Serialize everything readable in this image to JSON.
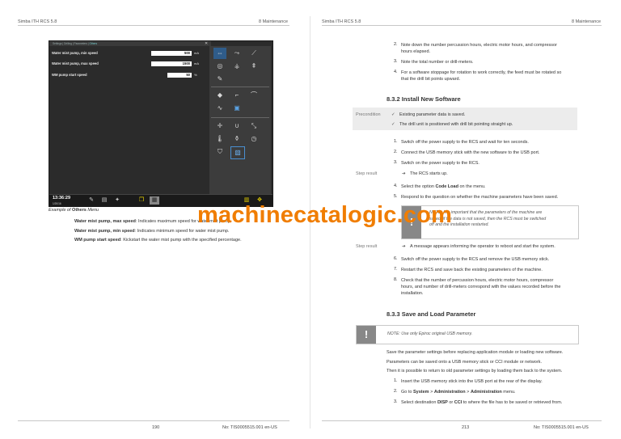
{
  "header": {
    "left_title": "Simba ITH RCS 5.8",
    "left_section": "8 Maintenance",
    "right_title": "Simba ITH RCS 5.8",
    "right_section": "8 Maintenance"
  },
  "screen": {
    "breadcrumb": "Settings | Drilling | Parameters |",
    "breadcrumb_active": "Others",
    "params": [
      {
        "label": "Water mist pump, min speed",
        "value": "500",
        "unit": "mA"
      },
      {
        "label": "Water mist pump, max speed",
        "value": "1500",
        "unit": "mA"
      },
      {
        "label": "WM pump start speed",
        "value": "50",
        "unit": "%"
      }
    ],
    "time": "13:36:29",
    "date": "1/20/16"
  },
  "left": {
    "caption_prefix": "Example of",
    "caption_bold": "Others",
    "caption_suffix": "Menu",
    "descriptions": [
      {
        "term": "Water mist pump, max speed",
        "text": ": Indicates maximum speed for water mist pump."
      },
      {
        "term": "Water mist pump, min speed",
        "text": ": Indicates minimum speed for water mist pump."
      },
      {
        "term": "WM pump start speed",
        "text": ": Kickstart the water mist pump with the specified percentage."
      }
    ],
    "page_number": "190",
    "doc_number": "No: TIS0005515.001 en-US"
  },
  "right": {
    "top_steps": [
      {
        "n": "2.",
        "lines": [
          "Note down the number percussion hours, electric motor hours, and compressor",
          "hours elapsed."
        ]
      },
      {
        "n": "3.",
        "lines": [
          "Note the total number or drill-meters."
        ]
      },
      {
        "n": "4.",
        "lines": [
          "For a software stoppage for rotation to work correctly, the feed must be rotated so",
          "that the drill bit points upward."
        ]
      }
    ],
    "section_install": "8.3.2 Install New Software",
    "precondition_label": "Precondition",
    "preconditions": [
      "Existing parameter data is saved.",
      "The drill unit is positioned with drill bit pointing straight up."
    ],
    "install_steps_a": [
      {
        "n": "1.",
        "text": "Switch off the power supply to the RCS and wait for ten seconds."
      },
      {
        "n": "2.",
        "text": "Connect the USB memory stick with the new software to the USB port."
      },
      {
        "n": "3.",
        "text": "Switch on the power supply to the RCS."
      }
    ],
    "step_result_label": "Step result",
    "step_result_1": "The RCS starts up.",
    "install_step_4_pre": "Select the option",
    "install_step_4_bold": "Code Load",
    "install_step_4_post": "on the menu.",
    "install_step_5": "Respond to the question on whether the machine parameters have been saved.",
    "note_1": [
      "NOTE: It is important that the parameters of the machine are",
      "saved; if the data is not saved, then the RCS must be switched",
      "off and the installation restarted."
    ],
    "step_result_2": "A message appears informing the operator to reboot and start the system.",
    "install_steps_b": [
      {
        "n": "6.",
        "lines": [
          "Switch off the power supply to the RCS and remove the USB memory stick."
        ]
      },
      {
        "n": "7.",
        "lines": [
          "Restart the RCS and save back the existing parameters of the machine."
        ]
      },
      {
        "n": "8.",
        "lines": [
          "Check that the number of percussion hours, electric motor hours, compressor",
          "hours, and number of drill-meters correspond with the values recorded before the",
          "installation."
        ]
      }
    ],
    "section_save": "8.3.3 Save and Load Parameter",
    "note_2": "NOTE: Use only Epiroc original USB memory.",
    "paras": [
      "Save the parameter settings before replacing application module or loading new software.",
      "Parameters can be saved onto a USB memory stick or CCI module or network.",
      "Then it is possible to return to old parameter settings by loading them back to the system."
    ],
    "save_step_1": "Insert the USB memory stick into the USB port at the rear of the display.",
    "save_step_2_pre": "Go to",
    "save_step_2_b1": "System",
    "save_step_2_sep1": " > ",
    "save_step_2_b2": "Administration",
    "save_step_2_sep2": " > ",
    "save_step_2_b3": "Administration",
    "save_step_2_post": " menu.",
    "save_step_3_pre": "Select destination",
    "save_step_3_b1": "DISP",
    "save_step_3_mid": " or ",
    "save_step_3_b2": "CCI",
    "save_step_3_post": " to where the file has to be saved or retrieved from.",
    "page_number": "213",
    "doc_number": "No: TIS0005515.001 en-US"
  },
  "watermark": "machinecatalogic.com",
  "colors": {
    "watermark": "#f07d00",
    "note_bar": "#888888",
    "highlight_icon": "#e8d200"
  }
}
